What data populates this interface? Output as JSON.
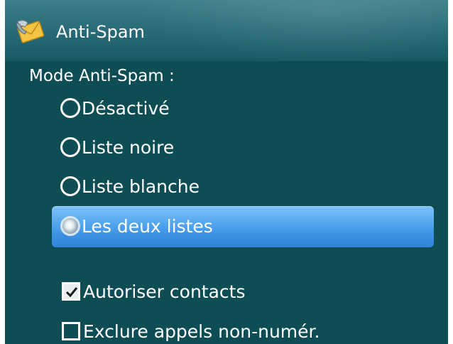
{
  "header": {
    "title": "Anti-Spam",
    "icon": "envelope-shield-icon"
  },
  "mode": {
    "label": "Mode Anti-Spam :",
    "options": [
      {
        "label": "Désactivé",
        "selected": false
      },
      {
        "label": "Liste noire",
        "selected": false
      },
      {
        "label": "Liste blanche",
        "selected": false
      },
      {
        "label": "Les deux listes",
        "selected": true
      }
    ]
  },
  "settings": [
    {
      "label": "Autoriser contacts",
      "checked": true
    },
    {
      "label": "Exclure appels non-numér.",
      "checked": false
    }
  ],
  "colors": {
    "background": "#0f4d55",
    "header": "#2a6d78",
    "selection": "#4a9eea",
    "text": "#ffffff"
  }
}
